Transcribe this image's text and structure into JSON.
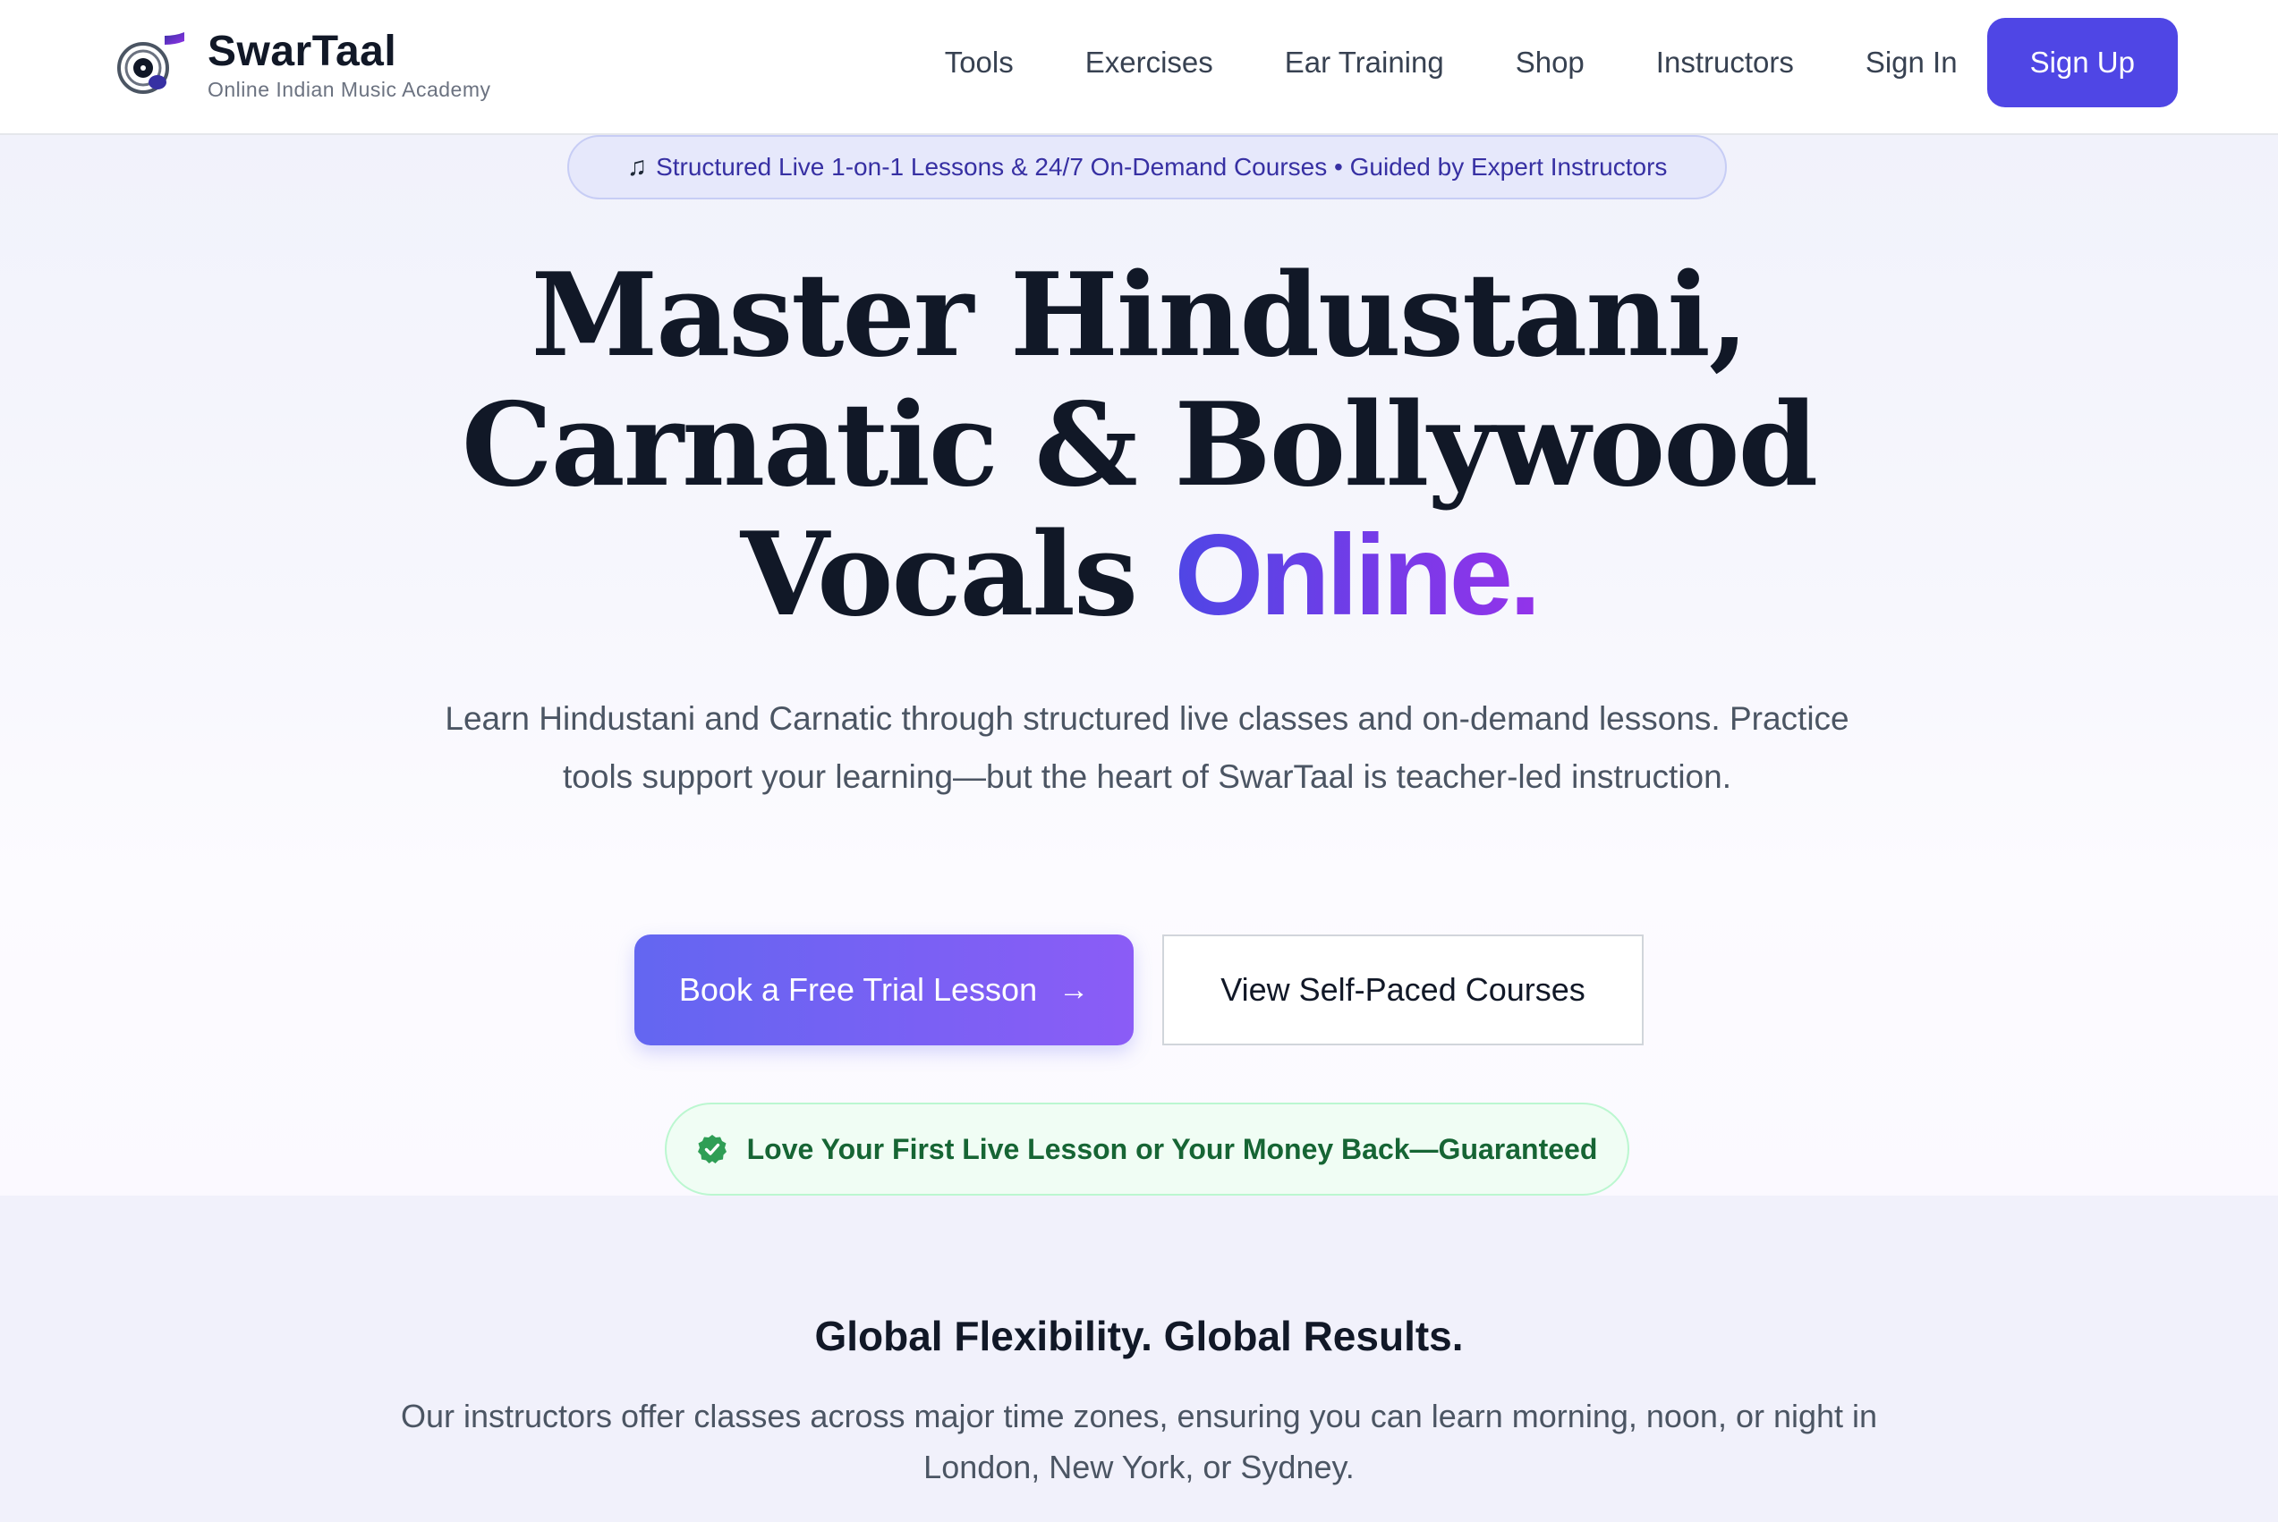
{
  "brand": {
    "name": "SwarTaal",
    "tagline": "Online Indian Music Academy",
    "colors": {
      "primary": "#4f46e5",
      "accent_end": "#9333ea"
    }
  },
  "nav": {
    "items": [
      "Tools",
      "Exercises",
      "Ear Training",
      "Shop",
      "Instructors"
    ],
    "sign_in": "Sign In",
    "sign_up": "Sign Up"
  },
  "hero": {
    "pill_icon": "music-note-icon",
    "pill_text": "Structured Live 1-on-1 Lessons & 24/7 On-Demand Courses • Guided by Expert Instructors",
    "headline_line1": "Master Hindustani,",
    "headline_line2": "Carnatic & Bollywood",
    "headline_line3": "Vocals",
    "headline_accent": "Online.",
    "subtext": "Learn Hindustani and Carnatic through structured live classes and on-demand lessons. Practice tools support your learning—but the heart of SwarTaal is teacher-led instruction.",
    "primary_cta": "Book a Free Trial Lesson",
    "primary_cta_icon": "arrow-right-icon",
    "secondary_cta": "View Self-Paced Courses",
    "guarantee_icon": "check-badge-icon",
    "guarantee": "Love Your First Live Lesson or Your Money Back—Guaranteed"
  },
  "global": {
    "title": "Global Flexibility. Global Results.",
    "text": "Our instructors offer classes across major time zones, ensuring you can learn morning, noon, or night in London, New York, or Sydney."
  }
}
